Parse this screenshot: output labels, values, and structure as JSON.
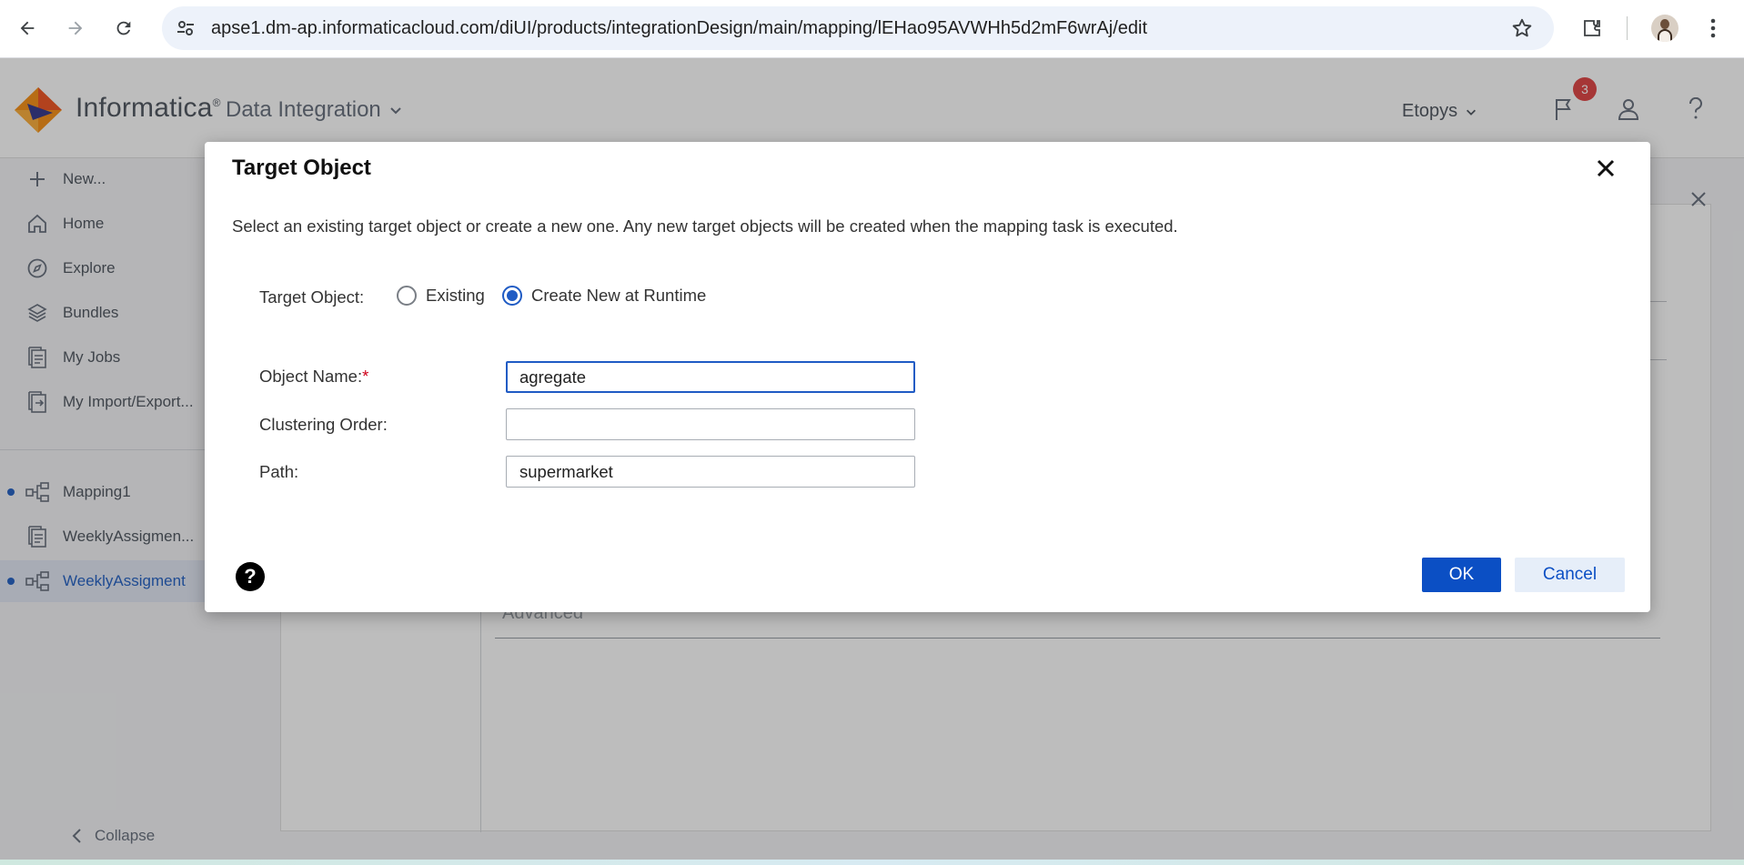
{
  "browser": {
    "url": "apse1.dm-ap.informaticacloud.com/diUI/products/integrationDesign/main/mapping/lEHao95AVWHh5d2mF6wrAj/edit"
  },
  "header": {
    "brand": "Informatica",
    "brand_mark": "®",
    "product": "Data Integration",
    "org": "Etopys",
    "notification_count": "3"
  },
  "sidebar": {
    "items": [
      {
        "label": "New...",
        "icon": "plus-icon"
      },
      {
        "label": "Home",
        "icon": "home-icon"
      },
      {
        "label": "Explore",
        "icon": "compass-icon"
      },
      {
        "label": "Bundles",
        "icon": "layers-icon"
      },
      {
        "label": "My Jobs",
        "icon": "jobs-icon"
      },
      {
        "label": "My Import/Export...",
        "icon": "import-export-icon"
      }
    ],
    "recent": [
      {
        "label": "Mapping1",
        "icon": "mapping-icon"
      },
      {
        "label": "WeeklyAssigmen...",
        "icon": "task-icon"
      },
      {
        "label": "WeeklyAssigment",
        "icon": "mapping-icon"
      }
    ],
    "collapse_label": "Collapse"
  },
  "background": {
    "advanced_label": "Advanced"
  },
  "dialog": {
    "title": "Target Object",
    "description": "Select an existing target object or create a new one. Any new target objects will be created when the mapping task is executed.",
    "target_object_label": "Target Object:",
    "radio_existing": "Existing",
    "radio_create": "Create New at Runtime",
    "selected_option": "Create New at Runtime",
    "object_name_label": "Object Name:",
    "required_mark": "*",
    "object_name_value": "agregate",
    "clustering_order_label": "Clustering Order:",
    "clustering_order_value": "",
    "path_label": "Path:",
    "path_value": "supermarket",
    "help_label": "?",
    "ok_label": "OK",
    "cancel_label": "Cancel"
  },
  "colors": {
    "primary": "#0b4fc4",
    "accent_blue": "#1f5bc4",
    "required": "#d0021b",
    "badge": "#e04a4a"
  }
}
